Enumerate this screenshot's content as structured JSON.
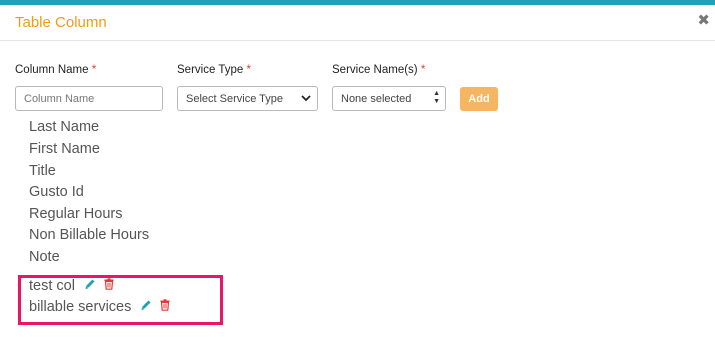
{
  "dialog": {
    "title": "Table Column",
    "close_glyph": "✖"
  },
  "form": {
    "column_name": {
      "label": "Column Name",
      "placeholder": "Column Name",
      "required_mark": "*"
    },
    "service_type": {
      "label": "Service Type",
      "selected": "Select Service Type",
      "required_mark": "*"
    },
    "service_names": {
      "label": "Service Name(s)",
      "selected": "None selected",
      "required_mark": "*"
    },
    "add_label": "Add"
  },
  "columns": {
    "default_items": [
      "Last Name",
      "First Name",
      "Title",
      "Gusto Id",
      "Regular Hours",
      "Non Billable Hours",
      "Note"
    ],
    "custom_items": [
      "test col",
      "billable services"
    ]
  },
  "colors": {
    "accent_title": "#f39c12",
    "top_bar": "#1fa2b4",
    "add_button": "#f7b461",
    "highlight_border": "#e8156b",
    "edit_icon": "#1fa2b4",
    "delete_icon": "#e53935"
  },
  "icons": {
    "edit": "pencil-icon",
    "delete": "trash-icon",
    "close": "close-icon"
  }
}
